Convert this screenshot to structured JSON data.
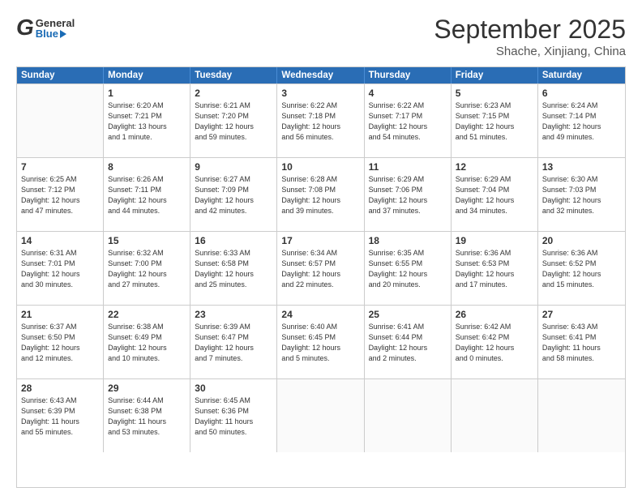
{
  "header": {
    "logo": {
      "general": "General",
      "blue": "Blue"
    },
    "title": "September 2025",
    "subtitle": "Shache, Xinjiang, China"
  },
  "calendar": {
    "days": [
      "Sunday",
      "Monday",
      "Tuesday",
      "Wednesday",
      "Thursday",
      "Friday",
      "Saturday"
    ],
    "weeks": [
      [
        {
          "day": "",
          "lines": []
        },
        {
          "day": "1",
          "lines": [
            "Sunrise: 6:20 AM",
            "Sunset: 7:21 PM",
            "Daylight: 13 hours",
            "and 1 minute."
          ]
        },
        {
          "day": "2",
          "lines": [
            "Sunrise: 6:21 AM",
            "Sunset: 7:20 PM",
            "Daylight: 12 hours",
            "and 59 minutes."
          ]
        },
        {
          "day": "3",
          "lines": [
            "Sunrise: 6:22 AM",
            "Sunset: 7:18 PM",
            "Daylight: 12 hours",
            "and 56 minutes."
          ]
        },
        {
          "day": "4",
          "lines": [
            "Sunrise: 6:22 AM",
            "Sunset: 7:17 PM",
            "Daylight: 12 hours",
            "and 54 minutes."
          ]
        },
        {
          "day": "5",
          "lines": [
            "Sunrise: 6:23 AM",
            "Sunset: 7:15 PM",
            "Daylight: 12 hours",
            "and 51 minutes."
          ]
        },
        {
          "day": "6",
          "lines": [
            "Sunrise: 6:24 AM",
            "Sunset: 7:14 PM",
            "Daylight: 12 hours",
            "and 49 minutes."
          ]
        }
      ],
      [
        {
          "day": "7",
          "lines": [
            "Sunrise: 6:25 AM",
            "Sunset: 7:12 PM",
            "Daylight: 12 hours",
            "and 47 minutes."
          ]
        },
        {
          "day": "8",
          "lines": [
            "Sunrise: 6:26 AM",
            "Sunset: 7:11 PM",
            "Daylight: 12 hours",
            "and 44 minutes."
          ]
        },
        {
          "day": "9",
          "lines": [
            "Sunrise: 6:27 AM",
            "Sunset: 7:09 PM",
            "Daylight: 12 hours",
            "and 42 minutes."
          ]
        },
        {
          "day": "10",
          "lines": [
            "Sunrise: 6:28 AM",
            "Sunset: 7:08 PM",
            "Daylight: 12 hours",
            "and 39 minutes."
          ]
        },
        {
          "day": "11",
          "lines": [
            "Sunrise: 6:29 AM",
            "Sunset: 7:06 PM",
            "Daylight: 12 hours",
            "and 37 minutes."
          ]
        },
        {
          "day": "12",
          "lines": [
            "Sunrise: 6:29 AM",
            "Sunset: 7:04 PM",
            "Daylight: 12 hours",
            "and 34 minutes."
          ]
        },
        {
          "day": "13",
          "lines": [
            "Sunrise: 6:30 AM",
            "Sunset: 7:03 PM",
            "Daylight: 12 hours",
            "and 32 minutes."
          ]
        }
      ],
      [
        {
          "day": "14",
          "lines": [
            "Sunrise: 6:31 AM",
            "Sunset: 7:01 PM",
            "Daylight: 12 hours",
            "and 30 minutes."
          ]
        },
        {
          "day": "15",
          "lines": [
            "Sunrise: 6:32 AM",
            "Sunset: 7:00 PM",
            "Daylight: 12 hours",
            "and 27 minutes."
          ]
        },
        {
          "day": "16",
          "lines": [
            "Sunrise: 6:33 AM",
            "Sunset: 6:58 PM",
            "Daylight: 12 hours",
            "and 25 minutes."
          ]
        },
        {
          "day": "17",
          "lines": [
            "Sunrise: 6:34 AM",
            "Sunset: 6:57 PM",
            "Daylight: 12 hours",
            "and 22 minutes."
          ]
        },
        {
          "day": "18",
          "lines": [
            "Sunrise: 6:35 AM",
            "Sunset: 6:55 PM",
            "Daylight: 12 hours",
            "and 20 minutes."
          ]
        },
        {
          "day": "19",
          "lines": [
            "Sunrise: 6:36 AM",
            "Sunset: 6:53 PM",
            "Daylight: 12 hours",
            "and 17 minutes."
          ]
        },
        {
          "day": "20",
          "lines": [
            "Sunrise: 6:36 AM",
            "Sunset: 6:52 PM",
            "Daylight: 12 hours",
            "and 15 minutes."
          ]
        }
      ],
      [
        {
          "day": "21",
          "lines": [
            "Sunrise: 6:37 AM",
            "Sunset: 6:50 PM",
            "Daylight: 12 hours",
            "and 12 minutes."
          ]
        },
        {
          "day": "22",
          "lines": [
            "Sunrise: 6:38 AM",
            "Sunset: 6:49 PM",
            "Daylight: 12 hours",
            "and 10 minutes."
          ]
        },
        {
          "day": "23",
          "lines": [
            "Sunrise: 6:39 AM",
            "Sunset: 6:47 PM",
            "Daylight: 12 hours",
            "and 7 minutes."
          ]
        },
        {
          "day": "24",
          "lines": [
            "Sunrise: 6:40 AM",
            "Sunset: 6:45 PM",
            "Daylight: 12 hours",
            "and 5 minutes."
          ]
        },
        {
          "day": "25",
          "lines": [
            "Sunrise: 6:41 AM",
            "Sunset: 6:44 PM",
            "Daylight: 12 hours",
            "and 2 minutes."
          ]
        },
        {
          "day": "26",
          "lines": [
            "Sunrise: 6:42 AM",
            "Sunset: 6:42 PM",
            "Daylight: 12 hours",
            "and 0 minutes."
          ]
        },
        {
          "day": "27",
          "lines": [
            "Sunrise: 6:43 AM",
            "Sunset: 6:41 PM",
            "Daylight: 11 hours",
            "and 58 minutes."
          ]
        }
      ],
      [
        {
          "day": "28",
          "lines": [
            "Sunrise: 6:43 AM",
            "Sunset: 6:39 PM",
            "Daylight: 11 hours",
            "and 55 minutes."
          ]
        },
        {
          "day": "29",
          "lines": [
            "Sunrise: 6:44 AM",
            "Sunset: 6:38 PM",
            "Daylight: 11 hours",
            "and 53 minutes."
          ]
        },
        {
          "day": "30",
          "lines": [
            "Sunrise: 6:45 AM",
            "Sunset: 6:36 PM",
            "Daylight: 11 hours",
            "and 50 minutes."
          ]
        },
        {
          "day": "",
          "lines": []
        },
        {
          "day": "",
          "lines": []
        },
        {
          "day": "",
          "lines": []
        },
        {
          "day": "",
          "lines": []
        }
      ]
    ]
  }
}
